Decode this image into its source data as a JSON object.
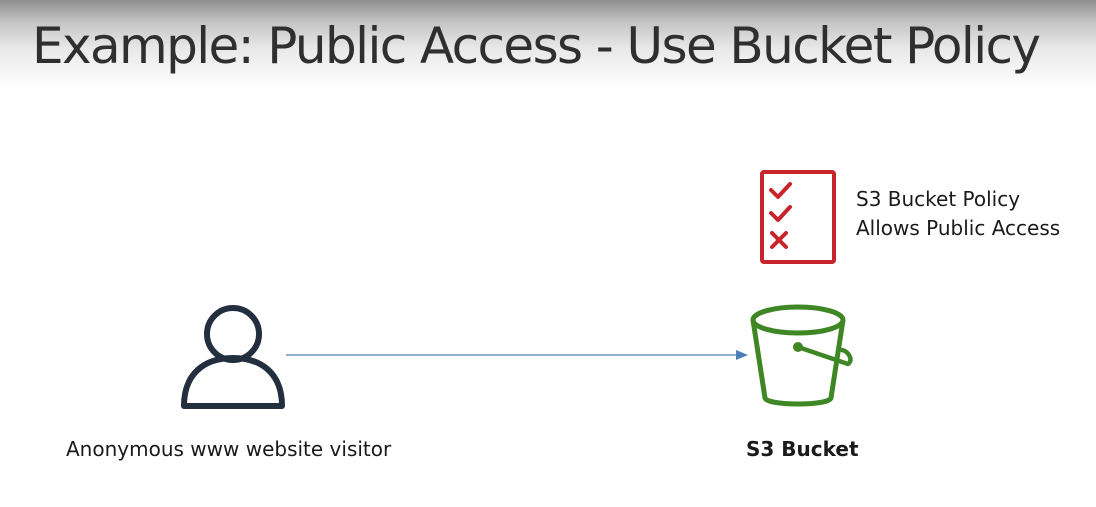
{
  "slide": {
    "title": "Example: Public Access - Use Bucket Policy"
  },
  "diagram": {
    "visitor": {
      "label": "Anonymous www website visitor",
      "icon": "user-icon"
    },
    "bucket": {
      "label": "S3 Bucket",
      "icon": "s3-bucket-icon",
      "color": "#3f8624"
    },
    "policy": {
      "line1": "S3 Bucket Policy",
      "line2": "Allows Public Access",
      "icon": "checklist-icon",
      "color": "#c7252c"
    },
    "connector": {
      "color": "#4a7fb5"
    }
  }
}
